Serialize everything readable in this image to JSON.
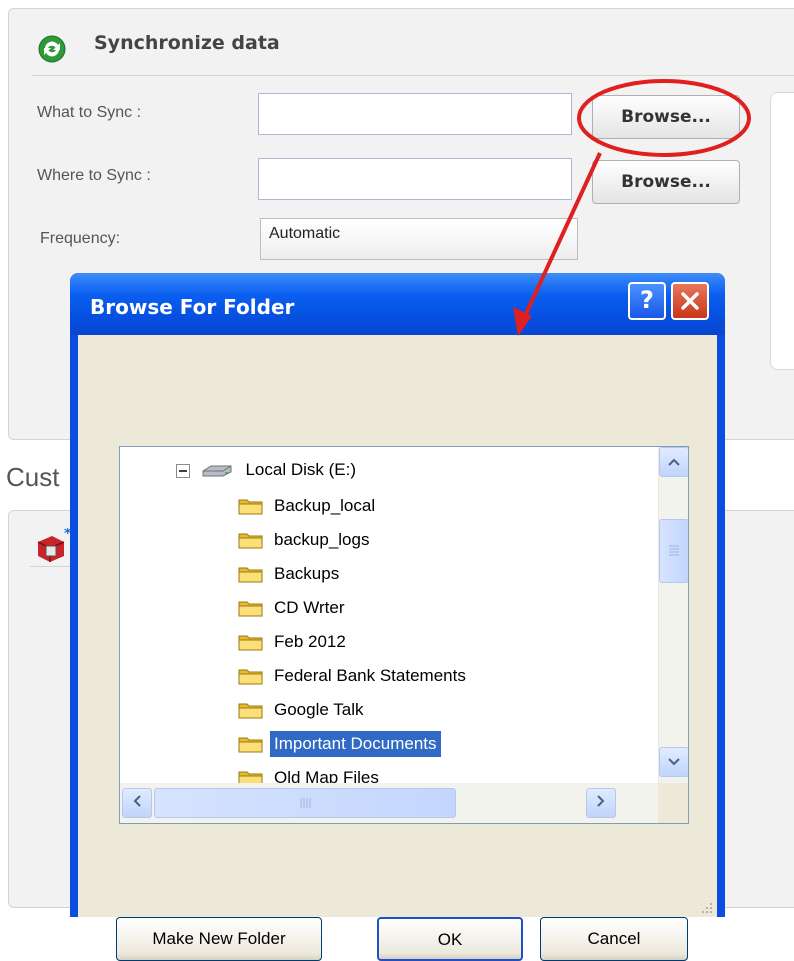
{
  "panel": {
    "title": "Synchronize data",
    "what_label": "What to Sync :",
    "where_label": "Where to Sync :",
    "frequency_label": "Frequency:",
    "frequency_value": "Automatic",
    "browse_what_label": "Browse...",
    "browse_where_label": "Browse..."
  },
  "section2": {
    "title_partial": "Cust"
  },
  "dialog": {
    "title": "Browse For Folder",
    "help_label": "?",
    "make_folder_label": "Make New Folder",
    "ok_label": "OK",
    "cancel_label": "Cancel",
    "tree": {
      "drive": "Local Disk (E:)",
      "folders": [
        {
          "label": "Backup_local",
          "selected": false
        },
        {
          "label": "backup_logs",
          "selected": false
        },
        {
          "label": "Backups",
          "selected": false
        },
        {
          "label": "CD Wrter",
          "selected": false
        },
        {
          "label": "Feb 2012",
          "selected": false
        },
        {
          "label": "Federal Bank Statements",
          "selected": false
        },
        {
          "label": "Google Talk",
          "selected": false
        },
        {
          "label": "Important Documents",
          "selected": true
        },
        {
          "label": "Old Map Files",
          "selected": false
        }
      ]
    }
  },
  "colors": {
    "annotation": "#e02020",
    "selection": "#316ac5",
    "titlebar": "#0a5ff0"
  }
}
